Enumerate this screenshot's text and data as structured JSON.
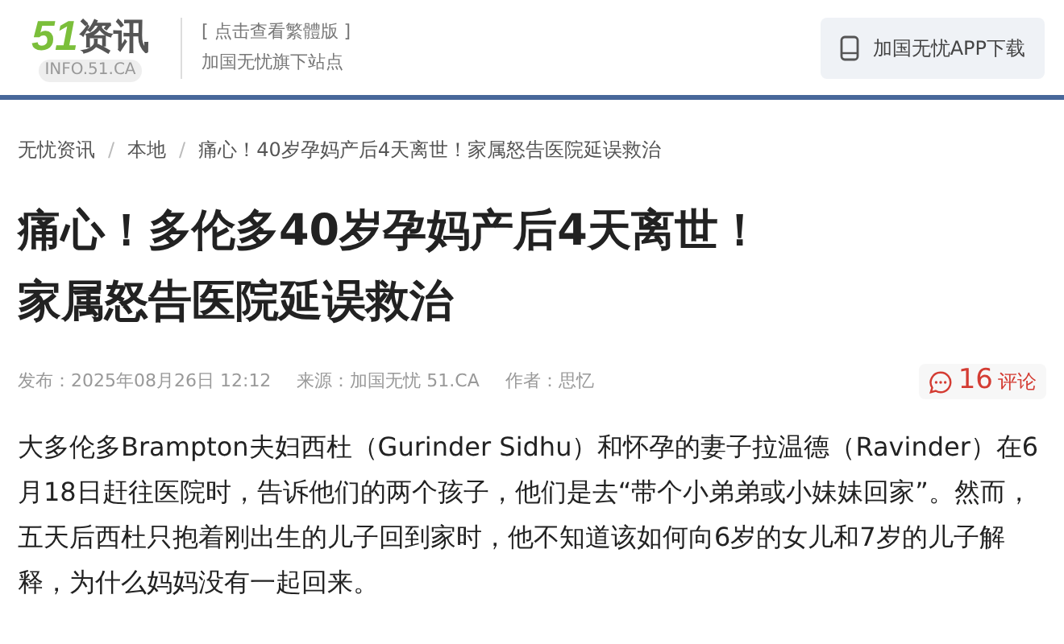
{
  "header": {
    "logo": {
      "number": "51",
      "name": "资讯",
      "domain": "INFO.51.CA"
    },
    "traditional_link": "[ 点击查看繁體版 ]",
    "tagline": "加国无忧旗下站点",
    "app_button": "加国无忧APP下载"
  },
  "breadcrumb": {
    "separator": "/",
    "items": [
      "无忧资讯",
      "本地",
      "痛心！40岁孕妈产后4天离世！家属怒告医院延误救治"
    ]
  },
  "article": {
    "title": "痛心！多伦多40岁孕妈产后4天离世！家属怒告医院延误救治",
    "published": "发布：2025年08月26日 12:12",
    "source": "来源：加国无忧 51.CA",
    "author": "作者：思忆",
    "comment_count": "16",
    "comment_label": "评论",
    "body": "大多伦多Brampton夫妇西杜（Gurinder Sidhu）和怀孕的妻子拉温德（Ravinder）在6月18日赶往医院时，告诉他们的两个孩子，他们是去“带个小弟弟或小妹妹回家”。然而，五天后西杜只抱着刚出生的儿子回到家时，他不知道该如何向6岁的女儿和7岁的儿子解释，为什么妈妈没有一起回来。"
  }
}
